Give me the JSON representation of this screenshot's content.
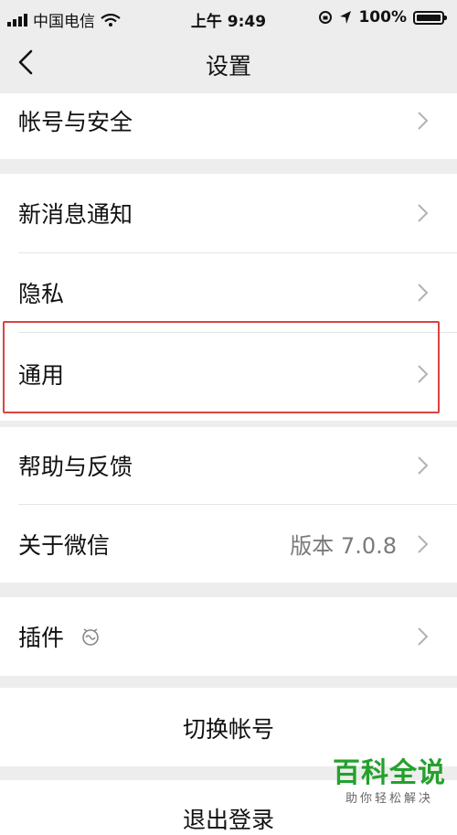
{
  "status_bar": {
    "carrier": "中国电信",
    "time": "上午 9:49",
    "battery": "100%",
    "icons": [
      "signal-icon",
      "wifi-icon",
      "lock-rotation-icon",
      "location-arrow-icon",
      "battery-icon"
    ]
  },
  "nav": {
    "title": "设置",
    "back_icon": "chevron-left-icon"
  },
  "settings": {
    "account_security": "帐号与安全",
    "new_message_notify": "新消息通知",
    "privacy": "隐私",
    "general": "通用",
    "help_feedback": "帮助与反馈",
    "about": "关于微信",
    "about_version": "版本 7.0.8",
    "plugins": "插件",
    "switch_account": "切换帐号",
    "logout": "退出登录"
  },
  "watermark": {
    "title": "百科全说",
    "subtitle": "助你轻松解决"
  },
  "colors": {
    "background": "#ededed",
    "highlight": "#d9443f",
    "watermark_green": "#24a12b"
  }
}
